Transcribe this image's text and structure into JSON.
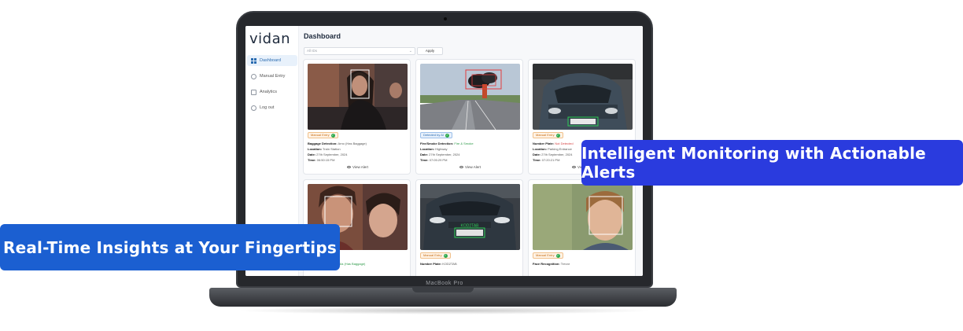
{
  "app": {
    "logo": "vidan",
    "nav": [
      {
        "label": "Dashboard",
        "icon": "grid-icon",
        "active": true
      },
      {
        "label": "Manual Entry",
        "icon": "user-icon",
        "active": false
      },
      {
        "label": "Analytics",
        "icon": "chart-icon",
        "active": false
      },
      {
        "label": "Log out",
        "icon": "logout-icon",
        "active": false
      }
    ],
    "page_title": "Dashboard",
    "filter": {
      "placeholder": "All IDs",
      "apply_label": "Apply"
    },
    "cards": [
      {
        "badge": "Manual Entry",
        "type_label": "Baggage Detection:",
        "type_value": "Arno (Has Baggage)",
        "location_label": "Location:",
        "location": "Train Station",
        "date_label": "Date:",
        "date": "27th September, 2024",
        "time_label": "Time:",
        "time": "06:50:15 PM",
        "action": "View Alert"
      },
      {
        "badge": "Detected by AI",
        "type_label": "Fire/Smoke Detection:",
        "type_value": "Fire & Smoke",
        "location_label": "Location:",
        "location": "Highway",
        "date_label": "Date:",
        "date": "27th September, 2024",
        "time_label": "Time:",
        "time": "07:05:29 PM",
        "action": "View Alert"
      },
      {
        "badge": "Manual Entry",
        "type_label": "Number Plate:",
        "type_value": "Not Detected",
        "location_label": "Location:",
        "location": "Parking Entrance",
        "date_label": "Date:",
        "date": "27th September, 2024",
        "time_label": "Time:",
        "time": "07:20:21 PM",
        "action": "View Alert"
      },
      {
        "badge": "",
        "type_label": "Baggage Detection:",
        "type_value": "Sila (Has Baggage)"
      },
      {
        "badge": "Manual Entry",
        "type_label": "Number Plate:",
        "type_value": "KOD2TAB"
      },
      {
        "badge": "Manual Entry",
        "type_label": "Face Recognition:",
        "type_value": "Trevor"
      }
    ]
  },
  "device_label": "MacBook Pro",
  "callouts": {
    "right": "Intelligent Monitoring with Actionable Alerts",
    "left": "Real-Time Insights at Your Fingertips"
  },
  "plate_text": "KOD2TAB",
  "colors": {
    "callout_right": "#2a3bde",
    "callout_left": "#1b5fd1",
    "accent": "#2b6cb0"
  }
}
